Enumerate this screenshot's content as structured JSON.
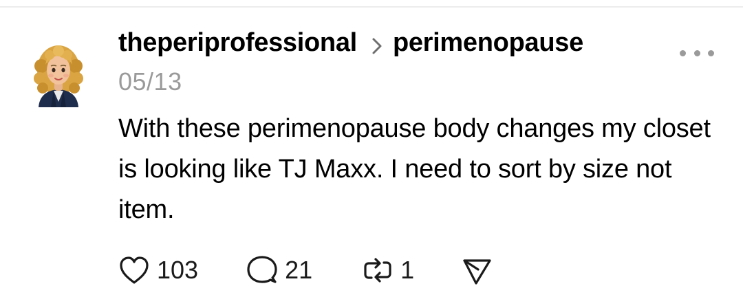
{
  "post": {
    "author": "theperiprofessional",
    "community": "perimenopause",
    "date": "05/13",
    "text": "With these perimenopause body changes my closet is looking like TJ Maxx. I need to sort by size not item."
  },
  "icons": {
    "avatar": "avatar-memoji-curly-blonde",
    "separator": "chevron-right-icon",
    "more": "more-dots-icon",
    "like": "heart-icon",
    "reply": "comment-bubble-icon",
    "repost": "repost-icon",
    "share": "send-icon"
  },
  "actions": {
    "likes": "103",
    "replies": "21",
    "reposts": "1"
  },
  "colors": {
    "text": "#000000",
    "muted": "#9a9a9a",
    "icon": "#1a1a1a",
    "divider": "#ececec"
  }
}
